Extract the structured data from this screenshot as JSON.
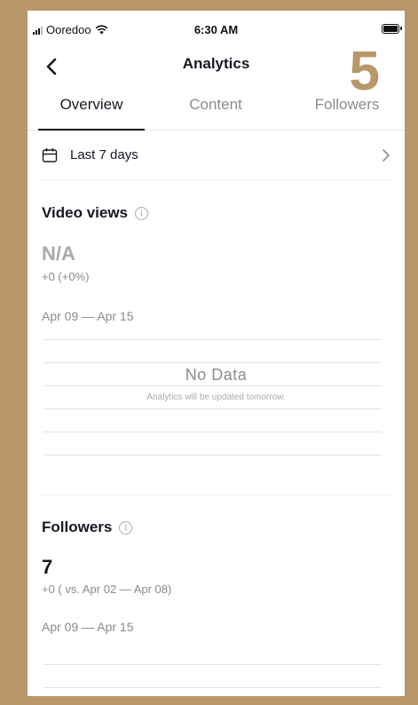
{
  "status_bar": {
    "carrier": "Ooredoo",
    "time": "6:30 AM"
  },
  "header": {
    "title": "Analytics",
    "badge": "5"
  },
  "tabs": [
    {
      "label": "Overview",
      "active": true
    },
    {
      "label": "Content",
      "active": false
    },
    {
      "label": "Followers",
      "active": false
    }
  ],
  "date_filter": {
    "label": "Last 7 days"
  },
  "video_views": {
    "title": "Video views",
    "value": "N/A",
    "change": "+0 (+0%)",
    "range": "Apr 09 — Apr 15",
    "empty_title": "No Data",
    "empty_subtitle": "Analytics will be updated tomorrow."
  },
  "followers": {
    "title": "Followers",
    "value": "7",
    "change": "+0 ( vs. Apr 02 — Apr 08)",
    "range": "Apr 09 — Apr 15"
  },
  "colors": {
    "frame": "#b8976a",
    "text_primary": "#161823",
    "text_secondary": "#8a8b91"
  }
}
